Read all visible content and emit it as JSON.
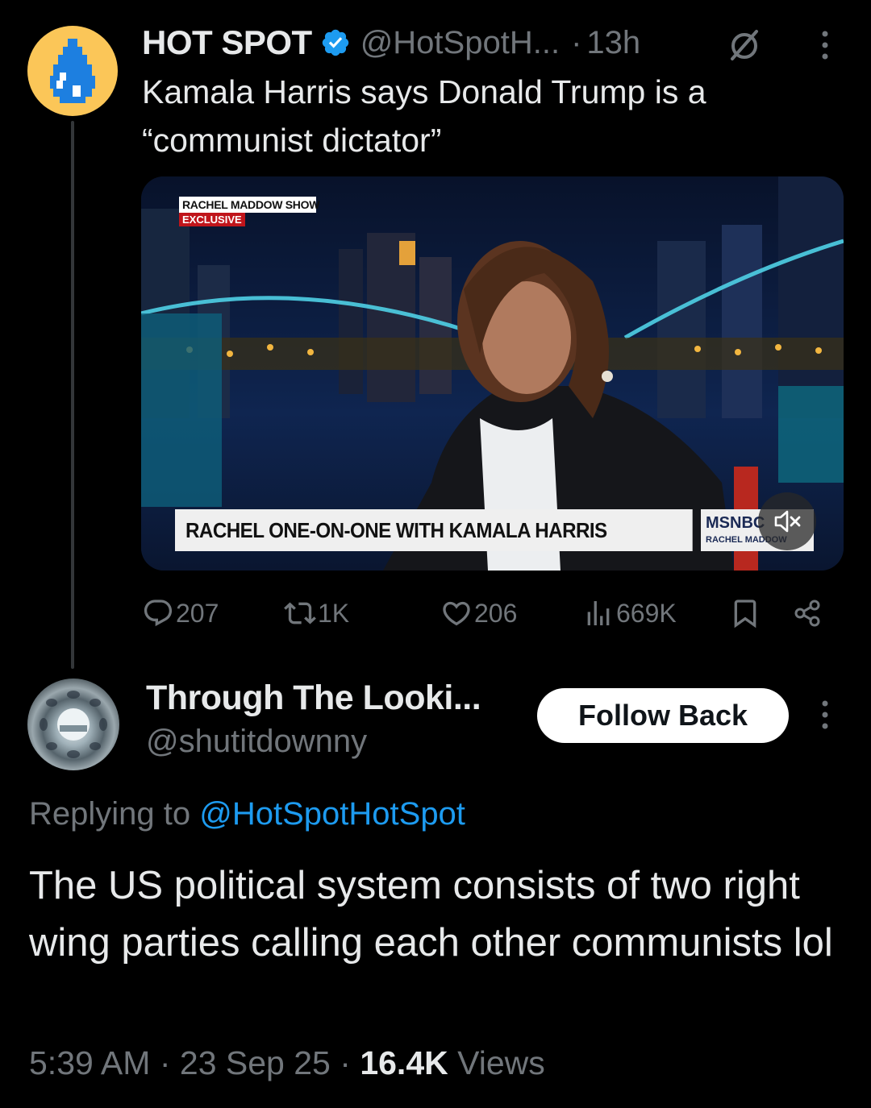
{
  "tweet": {
    "display_name": "HOT SPOT",
    "handle": "@HotSpotH...",
    "separator": "·",
    "time": "13h",
    "text": "Kamala Harris says Donald Trump is a “communist dictator”",
    "media": {
      "show_badge_top": "RACHEL MADDOW SHOW",
      "show_badge_bottom": "EXCLUSIVE",
      "lower_third": "RACHEL ONE-ON-ONE WITH KAMALA HARRIS",
      "network": "MSNBC",
      "network_show": "RACHEL MADDOW"
    },
    "stats": {
      "replies": "207",
      "reposts": "1K",
      "likes": "206",
      "views": "669K"
    },
    "avatar_color": "#fbc658"
  },
  "reply": {
    "display_name": "Through The Looki...",
    "handle": "@shutitdownny",
    "follow_label": "Follow Back",
    "replying_prefix": "Replying to",
    "replying_handle": "@HotSpotHotSpot",
    "text": "The US political system consists of two right wing parties calling each other communists lol",
    "time": "5:39 AM",
    "date": "23 Sep 25",
    "meta_sep": "·",
    "views_count": "16.4K",
    "views_label": "Views"
  },
  "colors": {
    "background": "#000000",
    "text": "#e7e9ea",
    "muted": "#71767b",
    "accent": "#1d9bf0",
    "verified": "#1d9bf0"
  },
  "icons": [
    "verified-badge-icon",
    "grok-icon",
    "more-icon",
    "reply-icon",
    "repost-icon",
    "like-icon",
    "views-icon",
    "bookmark-icon",
    "share-icon",
    "mute-icon"
  ]
}
